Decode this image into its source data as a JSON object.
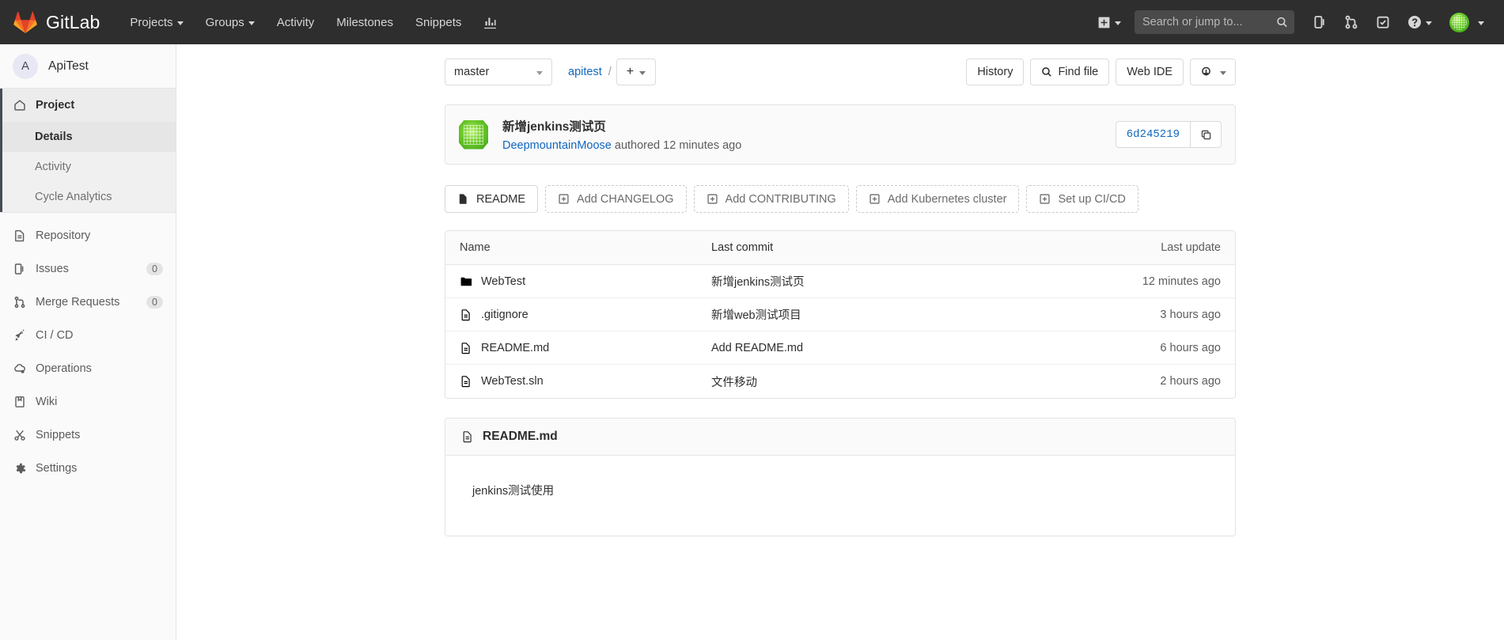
{
  "topbar": {
    "brand": "GitLab",
    "nav_items": [
      {
        "label": "Projects",
        "has_caret": true,
        "icon": ""
      },
      {
        "label": "Groups",
        "has_caret": true,
        "icon": ""
      },
      {
        "label": "Activity",
        "has_caret": false,
        "icon": ""
      },
      {
        "label": "Milestones",
        "has_caret": false,
        "icon": ""
      },
      {
        "label": "Snippets",
        "has_caret": false,
        "icon": ""
      }
    ],
    "analytics_icon": "chart-icon",
    "plus_icon": "plus-square-icon",
    "search_placeholder": "Search or jump to...",
    "search_value": "",
    "search_icon": "search-icon",
    "issues_icon": "issues-icon",
    "merge_requests_icon": "merge-request-icon",
    "todos_icon": "todo-check-icon",
    "help_icon": "question-circle-icon",
    "avatar_icon": "user-avatar"
  },
  "sidebar": {
    "project_initial": "A",
    "project_name": "ApiTest",
    "items": [
      {
        "label": "Project",
        "icon": "home-icon",
        "active": true,
        "badge": ""
      },
      {
        "label": "Repository",
        "icon": "file-document-icon",
        "active": false,
        "badge": ""
      },
      {
        "label": "Issues",
        "icon": "issues-icon",
        "active": false,
        "badge": "0"
      },
      {
        "label": "Merge Requests",
        "icon": "merge-request-icon",
        "active": false,
        "badge": "0"
      },
      {
        "label": "CI / CD",
        "icon": "rocket-icon",
        "active": false,
        "badge": ""
      },
      {
        "label": "Operations",
        "icon": "cloud-gear-icon",
        "active": false,
        "badge": ""
      },
      {
        "label": "Wiki",
        "icon": "book-icon",
        "active": false,
        "badge": ""
      },
      {
        "label": "Snippets",
        "icon": "scissors-icon",
        "active": false,
        "badge": ""
      },
      {
        "label": "Settings",
        "icon": "gear-icon",
        "active": false,
        "badge": ""
      }
    ],
    "subitems": [
      {
        "label": "Details",
        "active": true
      },
      {
        "label": "Activity",
        "active": false
      },
      {
        "label": "Cycle Analytics",
        "active": false
      }
    ]
  },
  "toolbar": {
    "branch": "master",
    "branch_caret_icon": "chevron-down-icon",
    "breadcrumb_root": "apitest",
    "breadcrumb_separator": "/",
    "plus_label": "+",
    "plus_caret_icon": "chevron-down-icon",
    "history_label": "History",
    "find_file_label": "Find file",
    "find_file_icon": "search-icon",
    "web_ide_label": "Web IDE",
    "download_icon": "download-code-icon",
    "download_caret_icon": "chevron-down-icon"
  },
  "commit": {
    "avatar_icon": "commit-author-avatar",
    "title": "新增jenkins测试页",
    "author": "DeepmountainMoose",
    "authored_text": "authored",
    "time": "12 minutes ago",
    "sha": "6d245219",
    "copy_icon": "copy-icon"
  },
  "actions": [
    {
      "label": "README",
      "icon": "file-document-icon",
      "dashed": false
    },
    {
      "label": "Add CHANGELOG",
      "icon": "plus-square-icon",
      "dashed": true
    },
    {
      "label": "Add CONTRIBUTING",
      "icon": "plus-square-icon",
      "dashed": true
    },
    {
      "label": "Add Kubernetes cluster",
      "icon": "plus-square-icon",
      "dashed": true
    },
    {
      "label": "Set up CI/CD",
      "icon": "plus-square-icon",
      "dashed": true
    }
  ],
  "file_table": {
    "headers": {
      "name": "Name",
      "last_commit": "Last commit",
      "last_update": "Last update"
    },
    "rows": [
      {
        "name": "WebTest",
        "icon": "folder-icon",
        "type": "folder",
        "last_commit": "新增jenkins测试页",
        "last_update": "12 minutes ago"
      },
      {
        "name": ".gitignore",
        "icon": "file-document-icon",
        "type": "file",
        "last_commit": "新增web测试项目",
        "last_update": "3 hours ago"
      },
      {
        "name": "README.md",
        "icon": "file-document-icon",
        "type": "file",
        "last_commit": "Add README.md",
        "last_update": "6 hours ago"
      },
      {
        "name": "WebTest.sln",
        "icon": "file-document-icon",
        "type": "file",
        "last_commit": "文件移动",
        "last_update": "2 hours ago"
      }
    ]
  },
  "readme": {
    "icon": "file-document-icon",
    "title": "README.md",
    "body": "jenkins测试使用"
  },
  "colors": {
    "topbar_bg": "#2e2e2e",
    "sidebar_bg": "#fafafa",
    "link": "#1068bf",
    "accent_orange": "#e24329",
    "border": "#e3e3e3"
  }
}
